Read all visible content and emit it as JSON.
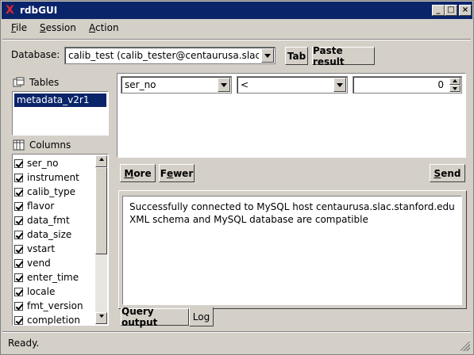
{
  "window": {
    "title": "rdbGUI",
    "app_icon": "x-icon",
    "controls": [
      "minimize-icon",
      "maximize-icon",
      "close-icon"
    ]
  },
  "menu": {
    "items": [
      {
        "label": "File",
        "accel": "F"
      },
      {
        "label": "Session",
        "accel": "S"
      },
      {
        "label": "Action",
        "accel": "A"
      }
    ]
  },
  "toolbar": {
    "database_label": "Database:",
    "database_value": "calib_test (calib_tester@centaurusa.slac.",
    "tab_button": "Tab",
    "paste_button": "Paste result"
  },
  "tables": {
    "header": "Tables",
    "items": [
      "metadata_v2r1"
    ],
    "selected": "metadata_v2r1"
  },
  "columns": {
    "header": "Columns",
    "items": [
      {
        "name": "ser_no",
        "checked": true
      },
      {
        "name": "instrument",
        "checked": true
      },
      {
        "name": "calib_type",
        "checked": true
      },
      {
        "name": "flavor",
        "checked": true
      },
      {
        "name": "data_fmt",
        "checked": true
      },
      {
        "name": "data_size",
        "checked": true
      },
      {
        "name": "vstart",
        "checked": true
      },
      {
        "name": "vend",
        "checked": true
      },
      {
        "name": "enter_time",
        "checked": true
      },
      {
        "name": "locale",
        "checked": true
      },
      {
        "name": "fmt_version",
        "checked": true
      },
      {
        "name": "completion",
        "checked": true
      }
    ]
  },
  "query": {
    "field": "ser_no",
    "operator": "<",
    "value": "0"
  },
  "buttons": {
    "more": "More",
    "fewer": "Fewer",
    "send": "Send"
  },
  "log": {
    "lines": [
      "Successfully connected to MySQL host centaurusa.slac.stanford.edu",
      "XML schema and MySQL database are compatible"
    ]
  },
  "tabs": [
    {
      "label": "Query output",
      "active": false
    },
    {
      "label": "Log",
      "active": true
    }
  ],
  "status": {
    "text": "Ready."
  },
  "colors": {
    "titlebar": "#0a246a",
    "window_bg": "#d4d0c8",
    "selection": "#0a246a"
  }
}
